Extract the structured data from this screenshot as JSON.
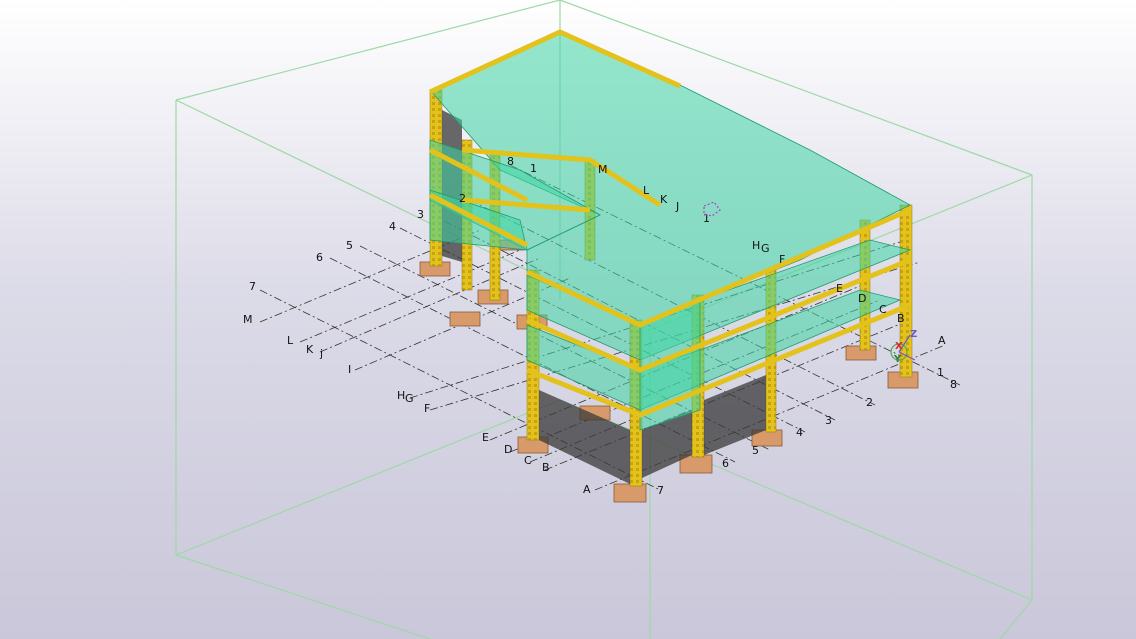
{
  "viewport": {
    "background_top": "#ffffff",
    "background_bottom": "#c9c7d9",
    "slab_color": "#3ed6a2",
    "frame_color": "#e3c21c",
    "footing_color": "#d89a6a",
    "bbox_color": "#8fd49a"
  },
  "gridlines_numbers": [
    "1",
    "2",
    "3",
    "4",
    "5",
    "6",
    "7",
    "8"
  ],
  "gridlines_letters": [
    "A",
    "B",
    "C",
    "D",
    "E",
    "F",
    "G",
    "H",
    "I",
    "j",
    "K",
    "L",
    "M",
    "J"
  ],
  "labels": {
    "n1a": "1",
    "n1b": "1",
    "n2a": "2",
    "n2b": "2",
    "n3a": "3",
    "n3b": "3",
    "n4a": "4",
    "n4b": "4",
    "n5a": "5",
    "n5b": "5",
    "n6a": "6",
    "n6b": "6",
    "n7a": "7",
    "n7b": "7",
    "n8a": "8",
    "n8b": "8",
    "la": "A",
    "la2": "A",
    "lb": "B",
    "lb2": "B",
    "lc": "C",
    "lc2": "C",
    "ld": "D",
    "ld2": "D",
    "le": "E",
    "le2": "E",
    "lf": "F",
    "lf2": "F",
    "lg": "G",
    "lg2": "G",
    "lh": "H",
    "lh2": "H",
    "li": "I",
    "lj": "j",
    "lk": "K",
    "lk2": "K",
    "ll": "L",
    "ll2": "L",
    "lm": "M",
    "lm2": "M",
    "lJ": "J"
  },
  "axis_triad": {
    "z": "Z",
    "x": "X",
    "y": "Y"
  }
}
